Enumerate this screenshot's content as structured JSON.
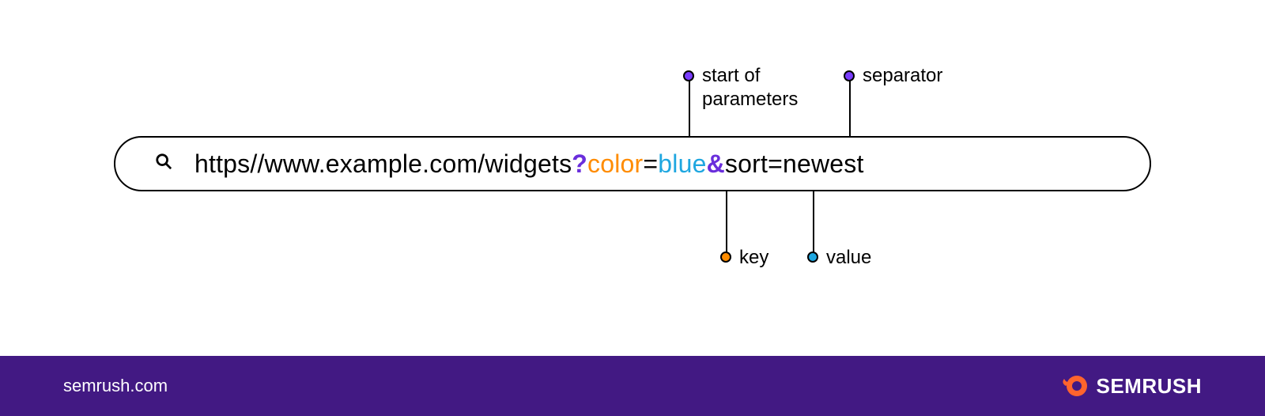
{
  "url_parts": {
    "base": "https//www.example.com/widgets",
    "qmark": "?",
    "key1": "color",
    "eq1": "=",
    "val1": "blue",
    "sep": "&",
    "key2": "sort",
    "eq2": "=",
    "val2": "newest"
  },
  "annotations": {
    "start_line1": "start of",
    "start_line2": "parameters",
    "separator": "separator",
    "key": "key",
    "value": "value"
  },
  "colors": {
    "purple": "#6a2edc",
    "orange": "#ff8c00",
    "blue": "#1fa7e0",
    "footer": "#421983"
  },
  "footer": {
    "link": "semrush.com",
    "brand": "SEMRUSH"
  }
}
